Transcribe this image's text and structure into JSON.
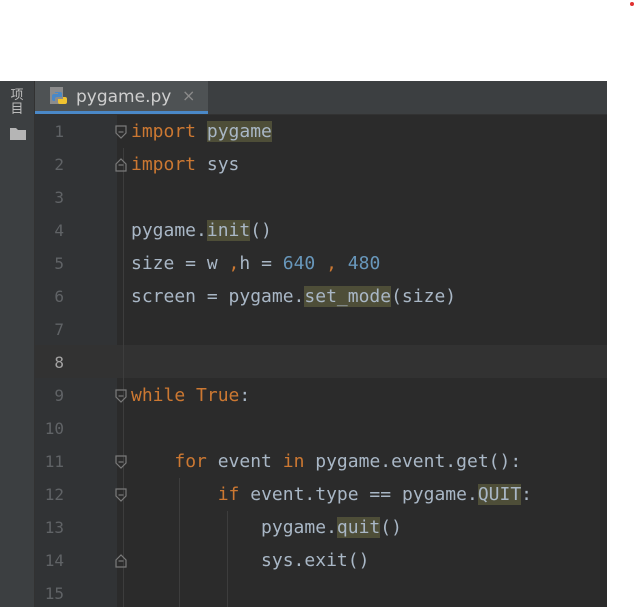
{
  "colors": {
    "keyword": "#cc7832",
    "number": "#6897bb",
    "text": "#a9b7c6",
    "usage_highlight": "#4e4e38",
    "line_number": "#606366"
  },
  "side_panel": {
    "label": "项目"
  },
  "tab": {
    "filename": "pygame.py",
    "close_glyph": "×",
    "icon": "python-file-icon"
  },
  "editor": {
    "current_line": 8,
    "lines": [
      {
        "n": "1",
        "tokens": [
          {
            "t": "kw",
            "v": "import"
          },
          {
            "t": "tx",
            "v": " "
          },
          {
            "t": "hl",
            "v": "pygame"
          }
        ]
      },
      {
        "n": "2",
        "tokens": [
          {
            "t": "kw",
            "v": "import"
          },
          {
            "t": "tx",
            "v": " sys"
          }
        ]
      },
      {
        "n": "3",
        "tokens": []
      },
      {
        "n": "4",
        "tokens": [
          {
            "t": "tx",
            "v": "pygame."
          },
          {
            "t": "hl",
            "v": "init"
          },
          {
            "t": "tx",
            "v": "()"
          }
        ]
      },
      {
        "n": "5",
        "tokens": [
          {
            "t": "tx",
            "v": "size = w "
          },
          {
            "t": "kw",
            "v": ","
          },
          {
            "t": "tx",
            "v": "h = "
          },
          {
            "t": "num",
            "v": "640"
          },
          {
            "t": "tx",
            "v": " "
          },
          {
            "t": "kw",
            "v": ","
          },
          {
            "t": "tx",
            "v": " "
          },
          {
            "t": "num",
            "v": "480"
          }
        ]
      },
      {
        "n": "6",
        "tokens": [
          {
            "t": "tx",
            "v": "screen = pygame."
          },
          {
            "t": "hl",
            "v": "set_mode"
          },
          {
            "t": "tx",
            "v": "(size)"
          }
        ]
      },
      {
        "n": "7",
        "tokens": []
      },
      {
        "n": "8",
        "tokens": []
      },
      {
        "n": "9",
        "tokens": [
          {
            "t": "kw",
            "v": "while"
          },
          {
            "t": "tx",
            "v": " "
          },
          {
            "t": "kw",
            "v": "True"
          },
          {
            "t": "tx",
            "v": ":"
          }
        ]
      },
      {
        "n": "10",
        "tokens": []
      },
      {
        "n": "11",
        "tokens": [
          {
            "t": "tx",
            "v": "    "
          },
          {
            "t": "kw",
            "v": "for"
          },
          {
            "t": "tx",
            "v": " event "
          },
          {
            "t": "kw",
            "v": "in"
          },
          {
            "t": "tx",
            "v": " pygame.event.get():"
          }
        ]
      },
      {
        "n": "12",
        "tokens": [
          {
            "t": "tx",
            "v": "        "
          },
          {
            "t": "kw",
            "v": "if"
          },
          {
            "t": "tx",
            "v": " event.type == pygame."
          },
          {
            "t": "hl",
            "v": "QUIT"
          },
          {
            "t": "tx",
            "v": ":"
          }
        ]
      },
      {
        "n": "13",
        "tokens": [
          {
            "t": "tx",
            "v": "            pygame."
          },
          {
            "t": "hl",
            "v": "quit"
          },
          {
            "t": "tx",
            "v": "()"
          }
        ]
      },
      {
        "n": "14",
        "tokens": [
          {
            "t": "tx",
            "v": "            sys.exit()"
          }
        ]
      },
      {
        "n": "15",
        "tokens": []
      }
    ]
  }
}
